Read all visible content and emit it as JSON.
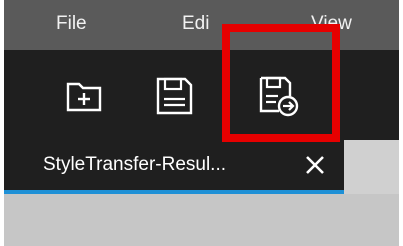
{
  "menubar": {
    "items": [
      {
        "label": "File"
      },
      {
        "label": "Edi"
      },
      {
        "label": "View"
      }
    ]
  },
  "toolbar": {
    "buttons": [
      {
        "icon": "new-folder-icon"
      },
      {
        "icon": "save-icon"
      },
      {
        "icon": "save-as-icon"
      }
    ]
  },
  "tabs": [
    {
      "title": "StyleTransfer-Resul...",
      "close_icon": "close-icon"
    }
  ],
  "colors": {
    "menubar_bg": "#5a5a5a",
    "toolbar_bg": "#1f1f1f",
    "active_tab_accent": "#1e90d6",
    "highlight": "#e60000"
  }
}
